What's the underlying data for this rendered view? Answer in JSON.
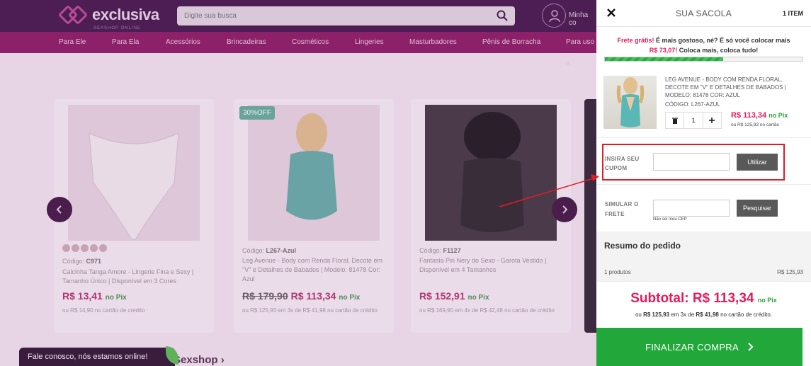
{
  "header": {
    "logo_text": "exclusiva",
    "logo_sub": "SEXSHOP ONLINE",
    "search_placeholder": "Digite sua busca",
    "account_label": "Minha co"
  },
  "categories": [
    "Para Ele",
    "Para Ela",
    "Acessórios",
    "Brincadeiras",
    "Cosméticos",
    "Lingeries",
    "Masturbadores",
    "Pênis de Borracha",
    "Para uso a"
  ],
  "products": [
    {
      "code_label": "Código:",
      "code": "C971",
      "name": "Calcinha Tanga Amore - Lingerie Fina e Sexy | Tamanho Único | Disponível em 3 Cores",
      "old_price": "",
      "price": "R$ 13,41",
      "pix": "no Pix",
      "installment": "ou R$ 14,90 no cartão de crédito",
      "badge": ""
    },
    {
      "code_label": "Código:",
      "code": "L267-Azul",
      "name": "Leg Avenue - Body com Renda Floral, Decote em \"V\" e Detalhes de Babados | Modelo: 81478 Cor: Azul",
      "old_price": "R$ 179,90",
      "price": "R$ 113,34",
      "pix": "no Pix",
      "installment": "ou R$ 125,93 em 3x de R$ 41,98 no cartão de crédito",
      "badge": "30%OFF"
    },
    {
      "code_label": "Código:",
      "code": "F1127",
      "name": "Fantasia Pin Nery do Sexo - Garota Vestido | Disponível em 4 Tamanhos",
      "old_price": "",
      "price": "R$ 152,91",
      "pix": "no Pix",
      "installment": "ou R$ 169,90 em 4x de R$ 42,48 no cartão de crédito",
      "badge": ""
    }
  ],
  "banner_text": "Sexshop",
  "chat_text": "Fale conosco, nós estamos online!",
  "cart": {
    "title": "SUA SACOLA",
    "item_count": "1 ITEM",
    "shipping_msg": {
      "lead": "Frete grátis!",
      "middle": " É mais gostoso, né? É só você colocar mais",
      "amount": "R$ 73,07!",
      "tail": " Coloca mais, coloca tudo!"
    },
    "shipping_progress": 0.6,
    "item": {
      "name": "LEG AVENUE - BODY COM RENDA FLORAL, DECOTE EM \"V\" E DETALHES DE BABADOS | MODELO: 81478 COR: AZUL",
      "code": "CÓDIGO: L267-AZUL",
      "quantity": "1",
      "price": "R$ 113,34",
      "pix": "no Pix",
      "card_price": "ou R$ 125,93 no cartão"
    },
    "coupon": {
      "label": "INSIRA SEU CUPOM",
      "button": "Utilizar",
      "value": ""
    },
    "freight": {
      "label": "SIMULAR O FRETE",
      "button": "Pesquisar",
      "cep_link": "Não sei meu CEP",
      "value": ""
    },
    "summary": {
      "title": "Resumo do pedido",
      "products_label": "1 produtos",
      "products_value": "R$ 125,93"
    },
    "subtotal": {
      "label": "Subtotal: R$ 113,34",
      "pix": "no Pix",
      "installments_prefix": "ou",
      "installments_total": "R$ 125,93",
      "installments_mid": "em 3x de",
      "installments_each": "R$ 41,98",
      "installments_suffix": "no cartão de crédito."
    },
    "checkout_label": "FINALIZAR COMPRA"
  },
  "colors": {
    "brand_purple": "#4d1e53",
    "brand_magenta": "#8c2069",
    "price_pink": "#e8195a",
    "pix_green": "#28a23b",
    "checkout_green": "#22a83a",
    "annotation_red": "#e31b23"
  }
}
